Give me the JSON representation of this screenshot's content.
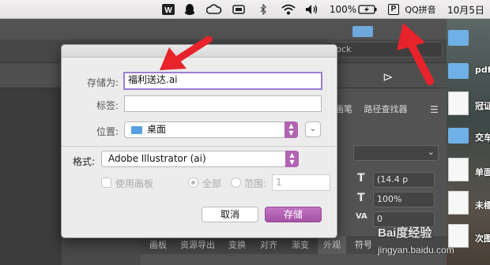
{
  "colors": {
    "accent_purple": "#b164b1",
    "annotation_red": "#e8232b",
    "dialog_bg": "#ececec"
  },
  "menubar": {
    "icons": [
      "wps-icon",
      "qq-penguin-icon",
      "creative-cloud-icon",
      "display-icon",
      "bluetooth-icon",
      "wifi-icon",
      "volume-icon"
    ],
    "battery_percent": "100%",
    "input_method_badge": "P",
    "input_method_label": "QQ拼音",
    "clock": "10月5日"
  },
  "background_app": {
    "search_placeholder": "tock",
    "panel_tabs": [
      "画笔",
      "路径查找器"
    ],
    "bottom_tabs": [
      "画板",
      "资源导出",
      "变换",
      "对齐",
      "渐变",
      "外观",
      "符号"
    ],
    "fields": {
      "size": "(14.4 p",
      "scale": "100%",
      "tracking": "0"
    }
  },
  "desktop": {
    "labels": [
      "pdf",
      "冠证",
      "交车",
      "单面",
      "未標",
      "次图"
    ]
  },
  "dialog": {
    "save_as_label": "存储为:",
    "save_as_value": "福利送达.ai",
    "tags_label": "标签:",
    "tags_value": "",
    "location_label": "位置:",
    "location_value": "桌面",
    "format_label": "格式:",
    "format_value": "Adobe Illustrator (ai)",
    "use_artboards_label": "使用画板",
    "all_label": "全部",
    "range_label": "范围:",
    "range_value": "1",
    "cancel_button": "取消",
    "save_button": "存储"
  },
  "watermark": {
    "text": "Bai度经验",
    "url": "jingyan.baidu.com"
  }
}
